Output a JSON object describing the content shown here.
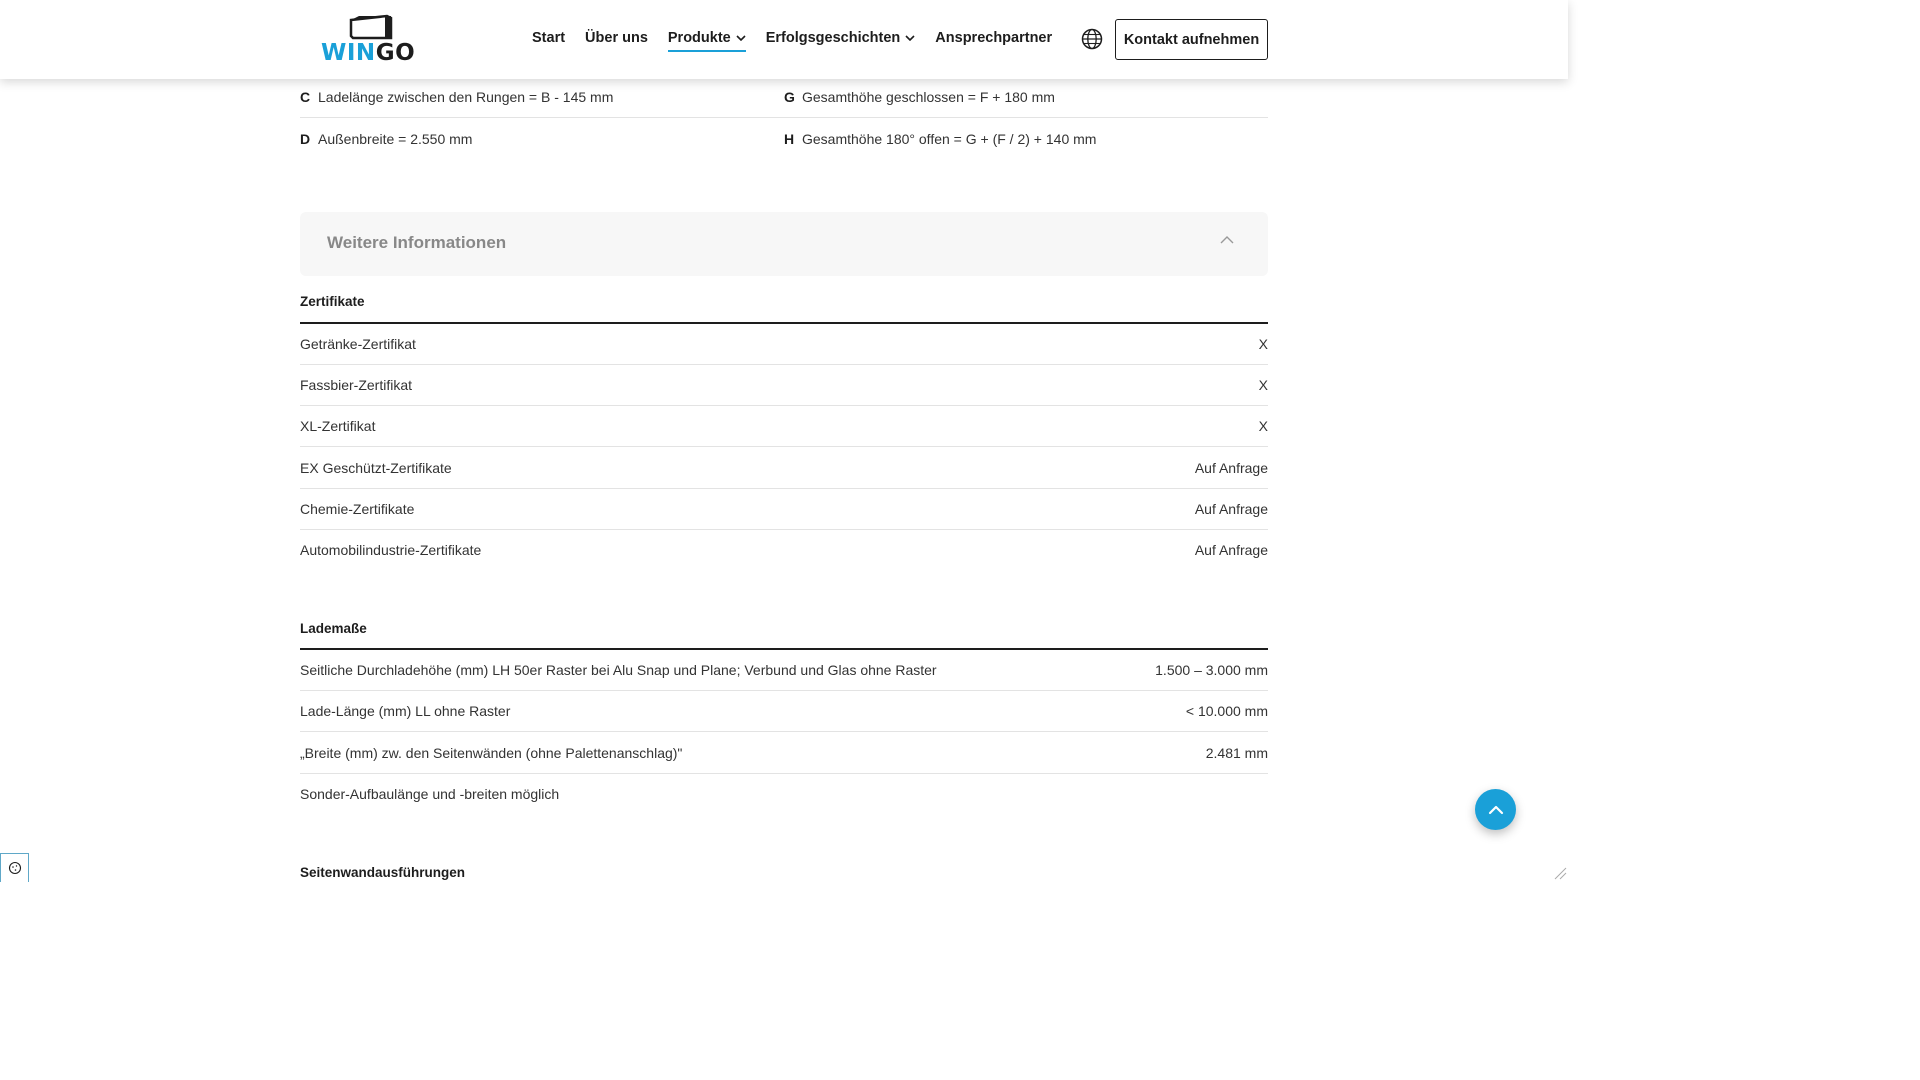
{
  "header": {
    "logo_text_a": "WIN",
    "logo_text_b": "GO",
    "nav": [
      {
        "label": "Start"
      },
      {
        "label": "Über uns"
      },
      {
        "label": "Produkte"
      },
      {
        "label": "Erfolgsgeschichten"
      },
      {
        "label": "Ansprechpartner"
      }
    ],
    "active_nav": "Produkte",
    "contact_label": "Kontakt aufnehmen",
    "icons": [
      "globe-icon",
      "chevron-down-icon"
    ]
  },
  "dimensions": {
    "left": [
      {
        "key": "C",
        "text": "Ladelänge zwischen den Rungen = B - 145 mm"
      },
      {
        "key": "D",
        "text": "Außenbreite = 2.550 mm"
      }
    ],
    "right": [
      {
        "key": "G",
        "text": "Gesamthöhe geschlossen = F + 180 mm"
      },
      {
        "key": "H",
        "text": "Gesamthöhe 180° offen = G + (F / 2) + 140 mm"
      }
    ]
  },
  "accordion": {
    "title": "Weitere Informationen",
    "state": "expanded"
  },
  "zertifikate": {
    "title": "Zertifikate",
    "rows": [
      {
        "label": "Getränke-Zertifikat",
        "value": "X"
      },
      {
        "label": "Fassbier-Zertifikat",
        "value": "X"
      },
      {
        "label": "XL-Zertifikat",
        "value": "X"
      },
      {
        "label": "EX Geschützt-Zertifikate",
        "value": "Auf Anfrage"
      },
      {
        "label": "Chemie-Zertifikate",
        "value": "Auf Anfrage"
      },
      {
        "label": "Automobilindustrie-Zertifikate",
        "value": "Auf Anfrage"
      }
    ]
  },
  "lademasse": {
    "title": "Lademaße",
    "rows": [
      {
        "label": "Seitliche Durchladehöhe (mm) LH 50er Raster bei Alu Snap und Plane; Verbund und Glas ohne Raster",
        "value": "1.500 – 3.000 mm"
      },
      {
        "label": "Lade-Länge (mm) LL ohne Raster",
        "value": "< 10.000 mm"
      },
      {
        "label": "„Breite (mm) zw. den Seitenwänden (ohne Palettenanschlag)\"",
        "value": "2.481 mm"
      },
      {
        "label": "Sonder-Aufbaulänge und -breiten möglich",
        "value": ""
      }
    ]
  },
  "seitenwand": {
    "title": "Seitenwandausführungen"
  },
  "colors": {
    "accent": "#1aa0d8",
    "text": "#1d1d1d",
    "accordion_bg": "#f7f7f7"
  }
}
